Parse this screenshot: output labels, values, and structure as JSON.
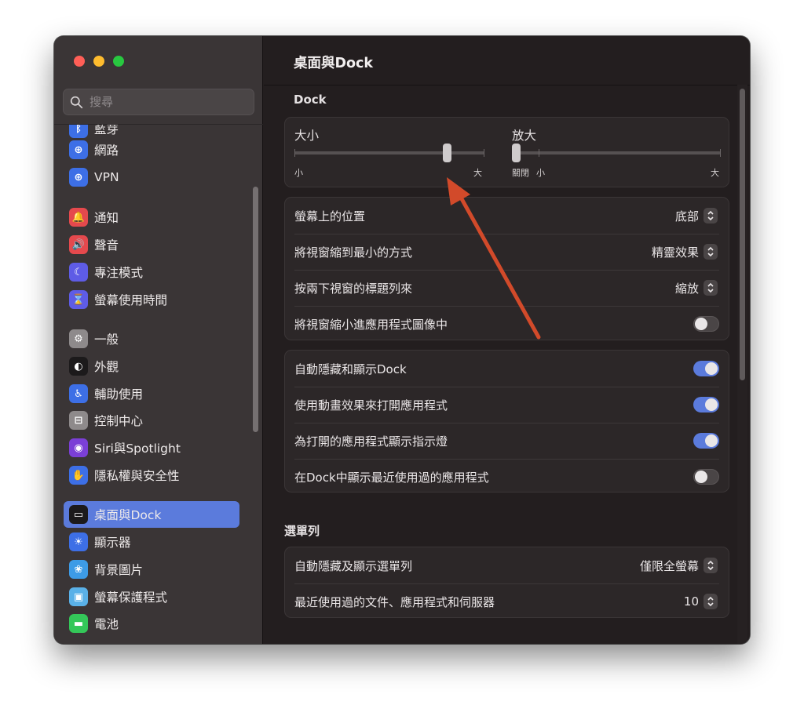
{
  "sidebar": {
    "search_placeholder": "搜尋",
    "items": [
      {
        "label": "藍芽",
        "icon": "bluetooth-icon",
        "color": "#3d6fe6",
        "glyph": "ᛒ"
      },
      {
        "label": "網路",
        "icon": "globe-icon",
        "color": "#3d6fe6",
        "glyph": "⊕"
      },
      {
        "label": "VPN",
        "icon": "vpn-globe-icon",
        "color": "#3d6fe6",
        "glyph": "⊕"
      },
      {
        "label": "通知",
        "icon": "bell-icon",
        "color": "#e5494d",
        "glyph": "🔔"
      },
      {
        "label": "聲音",
        "icon": "speaker-icon",
        "color": "#e5494d",
        "glyph": "🔊"
      },
      {
        "label": "專注模式",
        "icon": "moon-icon",
        "color": "#5e5ce6",
        "glyph": "☾"
      },
      {
        "label": "螢幕使用時間",
        "icon": "hourglass-icon",
        "color": "#5e5ce6",
        "glyph": "⌛"
      },
      {
        "label": "一般",
        "icon": "gear-icon",
        "color": "#8e8a8b",
        "glyph": "⚙"
      },
      {
        "label": "外觀",
        "icon": "appearance-icon",
        "color": "#1c1a1b",
        "glyph": "◐"
      },
      {
        "label": "輔助使用",
        "icon": "accessibility-icon",
        "color": "#3d6fe6",
        "glyph": "♿"
      },
      {
        "label": "控制中心",
        "icon": "control-center-icon",
        "color": "#8e8a8b",
        "glyph": "⊟"
      },
      {
        "label": "Siri與Spotlight",
        "icon": "siri-icon",
        "color": "#7b3fd6",
        "glyph": "◉"
      },
      {
        "label": "隱私權與安全性",
        "icon": "hand-icon",
        "color": "#3d6fe6",
        "glyph": "✋"
      },
      {
        "label": "桌面與Dock",
        "icon": "dock-icon",
        "color": "#1c1a1b",
        "glyph": "▭"
      },
      {
        "label": "顯示器",
        "icon": "display-brightness-icon",
        "color": "#3d6fe6",
        "glyph": "☀"
      },
      {
        "label": "背景圖片",
        "icon": "wallpaper-icon",
        "color": "#3d9be6",
        "glyph": "❀"
      },
      {
        "label": "螢幕保護程式",
        "icon": "screensaver-icon",
        "color": "#5ab1e8",
        "glyph": "▣"
      },
      {
        "label": "電池",
        "icon": "battery-icon",
        "color": "#34c759",
        "glyph": "▬"
      }
    ]
  },
  "main": {
    "title": "桌面與Dock",
    "dock_section": "Dock",
    "size_slider": {
      "label": "大小",
      "min_label": "小",
      "max_label": "大",
      "value": 0.82
    },
    "magnify_slider": {
      "label": "放大",
      "off_label": "關閉",
      "min_label": "小",
      "max_label": "大",
      "value": 0.0
    },
    "group1": [
      {
        "label": "螢幕上的位置",
        "type": "popup",
        "value": "底部"
      },
      {
        "label": "將視窗縮到最小的方式",
        "type": "popup",
        "value": "精靈效果"
      },
      {
        "label": "按兩下視窗的標題列來",
        "type": "popup",
        "value": "縮放"
      },
      {
        "label": "將視窗縮小進應用程式圖像中",
        "type": "toggle",
        "on": false
      }
    ],
    "group2": [
      {
        "label": "自動隱藏和顯示Dock",
        "type": "toggle",
        "on": true
      },
      {
        "label": "使用動畫效果來打開應用程式",
        "type": "toggle",
        "on": true
      },
      {
        "label": "為打開的應用程式顯示指示燈",
        "type": "toggle",
        "on": true
      },
      {
        "label": "在Dock中顯示最近使用過的應用程式",
        "type": "toggle",
        "on": false
      }
    ],
    "menubar_section": "選單列",
    "group3": [
      {
        "label": "自動隱藏及顯示選單列",
        "type": "popup",
        "value": "僅限全螢幕"
      },
      {
        "label": "最近使用過的文件、應用程式和伺服器",
        "type": "popup",
        "value": "10"
      }
    ]
  },
  "colors": {
    "accent": "#5b7bdc",
    "arrow": "#d24a2a"
  }
}
